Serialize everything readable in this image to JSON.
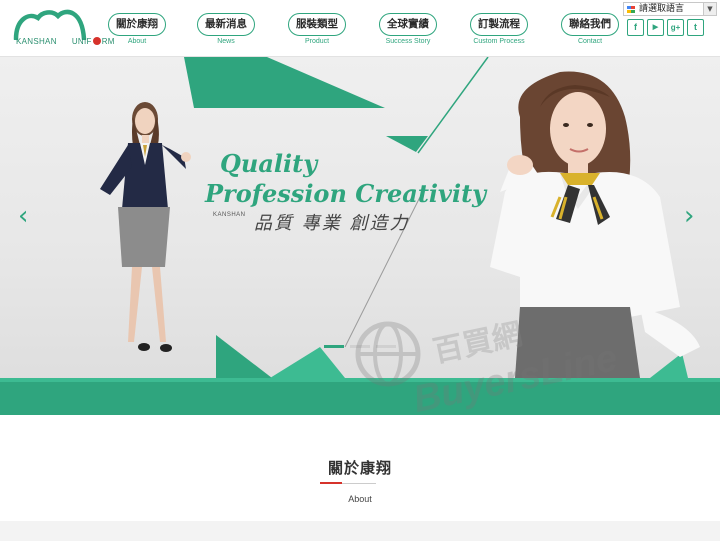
{
  "brand": {
    "logo_text_1": "KANSHAN",
    "logo_text_2": "UNIF",
    "logo_text_3": "RM",
    "primary_color": "#2fa57e",
    "accent_color": "#d6322b"
  },
  "nav": {
    "items": [
      {
        "zh": "關於康翔",
        "en": "About"
      },
      {
        "zh": "最新消息",
        "en": "News"
      },
      {
        "zh": "服裝類型",
        "en": "Product"
      },
      {
        "zh": "全球實績",
        "en": "Success Story"
      },
      {
        "zh": "訂製流程",
        "en": "Custom Process"
      },
      {
        "zh": "聯絡我們",
        "en": "Contact"
      }
    ]
  },
  "language": {
    "label": "請選取語言",
    "arrow": "▼"
  },
  "social": [
    {
      "icon": "facebook-icon",
      "glyph": "f"
    },
    {
      "icon": "youtube-icon",
      "glyph": "▶"
    },
    {
      "icon": "google-plus-icon",
      "glyph": "g+"
    },
    {
      "icon": "twitter-icon",
      "glyph": "t"
    }
  ],
  "hero": {
    "slogan_line1": "Quality",
    "slogan_line2": "Profession Creativity",
    "brand_small": "KANSHAN",
    "slogan_zh": "品質 專業 創造力",
    "prev_arrow": "‹",
    "next_arrow": "›",
    "slides_total": 3,
    "slide_active": 1
  },
  "watermark": {
    "zh": "百買網",
    "en": "BuyersLine"
  },
  "about": {
    "title": "關於康翔",
    "subtitle": "About"
  }
}
